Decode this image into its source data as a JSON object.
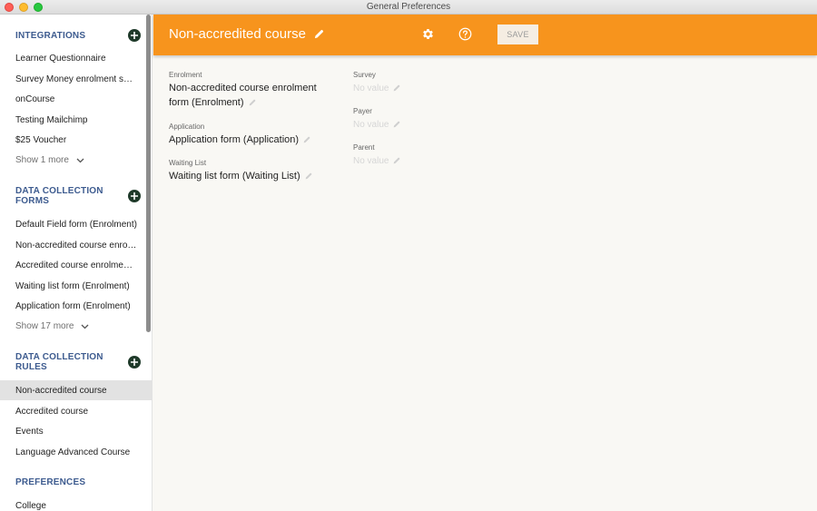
{
  "window": {
    "title": "General Preferences"
  },
  "sidebar": {
    "integrations": {
      "heading": "INTEGRATIONS",
      "items": [
        "Learner Questionnaire",
        "Survey Money enrolment survey",
        "onCourse",
        "Testing Mailchimp",
        "$25 Voucher"
      ],
      "show_more": "Show 1 more"
    },
    "forms": {
      "heading": "DATA COLLECTION FORMS",
      "items": [
        "Default Field form (Enrolment)",
        "Non-accredited course enrolment form (Enrolment)",
        "Accredited course enrolment form (Enrolment)",
        "Waiting list form (Enrolment)",
        "Application form (Enrolment)"
      ],
      "show_more": "Show 17 more"
    },
    "rules": {
      "heading": "DATA COLLECTION RULES",
      "items": [
        "Non-accredited course",
        "Accredited course",
        "Events",
        "Language Advanced Course"
      ],
      "active_index": 0
    },
    "preferences": {
      "heading": "PREFERENCES",
      "items": [
        "College"
      ]
    }
  },
  "header": {
    "title": "Non-accredited course",
    "save_label": "SAVE",
    "accent_color": "#f7941d"
  },
  "form": {
    "enrolment": {
      "label": "Enrolment",
      "value": "Non-accredited course enrolment form (Enrolment)"
    },
    "application": {
      "label": "Application",
      "value": "Application form (Application)"
    },
    "waiting_list": {
      "label": "Waiting List",
      "value": "Waiting list form (Waiting List)"
    },
    "survey": {
      "label": "Survey",
      "value": "No value"
    },
    "payer": {
      "label": "Payer",
      "value": "No value"
    },
    "parent": {
      "label": "Parent",
      "value": "No value"
    }
  }
}
